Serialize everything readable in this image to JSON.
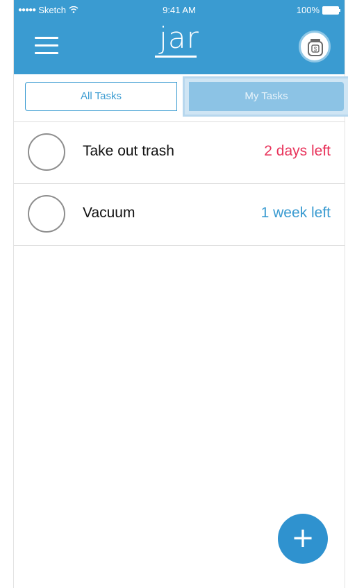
{
  "status_bar": {
    "carrier": "Sketch",
    "time": "9:41 AM",
    "battery": "100%"
  },
  "header": {
    "logo": "jar"
  },
  "tabs": {
    "all": "All Tasks",
    "mine": "My Tasks"
  },
  "tasks": [
    {
      "name": "Take out trash",
      "due": "2 days left",
      "due_color": "#e8325a"
    },
    {
      "name": "Vacuum",
      "due": "1 week left",
      "due_color": "#3a9bd1"
    }
  ],
  "fab": {
    "label": "+"
  },
  "colors": {
    "primary": "#3a9bd1",
    "overdue_red": "#e8325a"
  },
  "icons": {
    "menu": "hamburger-icon",
    "jar": "money-jar-icon",
    "wifi": "wifi-icon",
    "battery": "battery-icon"
  }
}
